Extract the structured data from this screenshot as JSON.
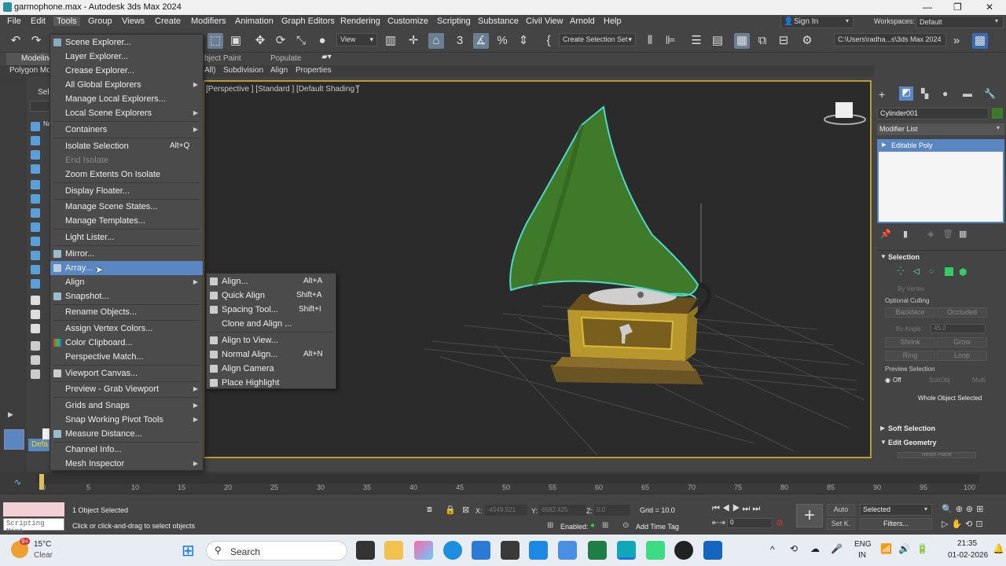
{
  "window": {
    "title": "garmophone.max - Autodesk 3ds Max 2024"
  },
  "menubar": {
    "items": [
      "File",
      "Edit",
      "Tools",
      "Group",
      "Views",
      "Create",
      "Modifiers",
      "Animation",
      "Graph Editors",
      "Rendering",
      "Customize",
      "Scripting",
      "Substance",
      "Civil View",
      "Arnold",
      "Help"
    ],
    "sign_in": "Sign In",
    "workspaces_label": "Workspaces:",
    "workspaces_value": "Default"
  },
  "toolbar": {
    "view_dropdown": "View",
    "selection_set": "Create Selection Set",
    "path": "C:\\Users\\radha...s\\3ds Max 2024"
  },
  "ribbon": {
    "tab_modeling": "Modeling",
    "tab_object_paint": "bject Paint",
    "tab_populate": "Populate",
    "sub_polygon": "Polygon Mo",
    "sub_all": "All)",
    "sub_subdivision": "Subdivision",
    "sub_align": "Align",
    "sub_properties": "Properties"
  },
  "scene_explorer": {
    "select_label": "Sele",
    "name_label": "Na",
    "layer_label": "Defa"
  },
  "viewport": {
    "label": "[Perspective ] [Standard ] [Default Shading ]",
    "hidden_label": "Perspective"
  },
  "tools_menu": {
    "items": [
      {
        "label": "Scene Explorer..."
      },
      {
        "label": "Layer Explorer..."
      },
      {
        "label": "Crease Explorer..."
      },
      {
        "label": "All Global Explorers"
      },
      {
        "label": "Manage Local Explorers..."
      },
      {
        "label": "Local Scene Explorers"
      },
      {
        "label": "Containers"
      },
      {
        "label": "Isolate Selection",
        "shortcut": "Alt+Q"
      },
      {
        "label": "End Isolate"
      },
      {
        "label": "Zoom Extents On Isolate"
      },
      {
        "label": "Display Floater..."
      },
      {
        "label": "Manage Scene States..."
      },
      {
        "label": "Manage Templates..."
      },
      {
        "label": "Light Lister..."
      },
      {
        "label": "Mirror..."
      },
      {
        "label": "Array..."
      },
      {
        "label": "Align"
      },
      {
        "label": "Snapshot..."
      },
      {
        "label": "Rename Objects..."
      },
      {
        "label": "Assign Vertex Colors..."
      },
      {
        "label": "Color Clipboard..."
      },
      {
        "label": "Perspective Match..."
      },
      {
        "label": "Viewport Canvas..."
      },
      {
        "label": "Preview - Grab Viewport"
      },
      {
        "label": "Grids and Snaps"
      },
      {
        "label": "Snap Working Pivot Tools"
      },
      {
        "label": "Measure Distance..."
      },
      {
        "label": "Channel Info..."
      },
      {
        "label": "Mesh Inspector"
      }
    ]
  },
  "align_submenu": {
    "items": [
      {
        "label": "Align...",
        "shortcut": "Alt+A"
      },
      {
        "label": "Quick Align",
        "shortcut": "Shift+A"
      },
      {
        "label": "Spacing Tool...",
        "shortcut": "Shift+I"
      },
      {
        "label": "Clone and Align ..."
      },
      {
        "label": "Align to View..."
      },
      {
        "label": "Normal Align...",
        "shortcut": "Alt+N"
      },
      {
        "label": "Align Camera"
      },
      {
        "label": "Place Highlight"
      }
    ]
  },
  "command_panel": {
    "object_name": "Cylinder001",
    "modifier_list": "Modifier List",
    "modifier_stack_item": "Editable Poly",
    "selection_header": "Selection",
    "by_vertex": "By Vertex",
    "optional_culling": "Optional Culling",
    "backface": "Backface",
    "occluded": "Occluded",
    "by_angle": "By Angle:",
    "by_angle_value": "45.0",
    "shrink": "Shrink",
    "grow": "Grow",
    "ring": "Ring",
    "loop": "Loop",
    "preview_selection": "Preview Selection",
    "off": "Off",
    "subobj": "SubObj",
    "multi": "Multi",
    "whole_object_selected": "Whole Object Selected",
    "soft_selection": "Soft Selection",
    "edit_geometry": "Edit Geometry",
    "reset_plane": "Reset Plane"
  },
  "timeline": {
    "frame_counter": "0 / 100",
    "ticks": [
      "0",
      "5",
      "10",
      "15",
      "20",
      "25",
      "30",
      "35",
      "40",
      "45",
      "50",
      "55",
      "60",
      "65",
      "70",
      "75",
      "80",
      "85",
      "90",
      "95",
      "100"
    ]
  },
  "status": {
    "maxscript": "Scripting Mini",
    "objects_selected": "1 Object Selected",
    "prompt": "Click or click-and-drag to select objects",
    "x_label": "X:",
    "x_value": "-4549.521",
    "y_label": "Y:",
    "y_value": "6582.425",
    "z_label": "Z:",
    "z_value": "0.0",
    "grid": "Grid = 10.0",
    "enabled": "Enabled:",
    "add_time_tag": "Add Time Tag",
    "auto": "Auto",
    "selected": "Selected",
    "set_key": "Set K.",
    "filters": "Filters...",
    "frame": "0"
  },
  "taskbar": {
    "weather_temp": "15°C",
    "weather_desc": "Clear",
    "weather_badge": "9+",
    "search": "Search",
    "lang1": "ENG",
    "lang2": "IN",
    "time": "21:35",
    "date": "01-02-2026"
  },
  "colors": {
    "accent": "#5a87c2",
    "viewport_border": "#b89c32",
    "horn": "#3f7a2a",
    "outline": "#4dd9c8"
  }
}
